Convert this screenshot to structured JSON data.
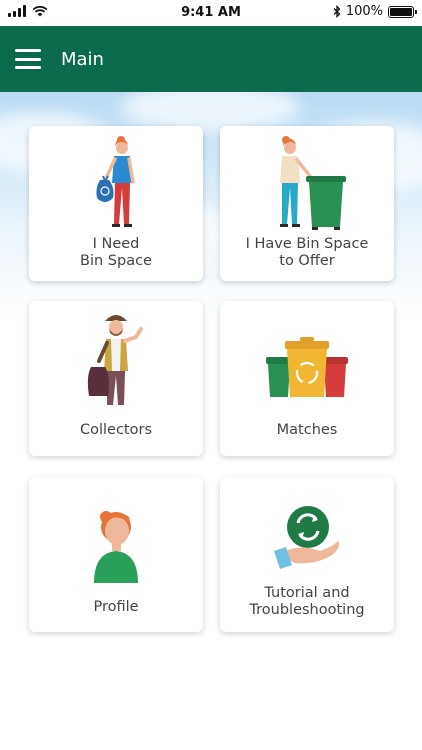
{
  "status_bar": {
    "time": "9:41 AM",
    "battery": "100%"
  },
  "app_bar": {
    "title": "Main",
    "menu_icon": "hamburger-menu-icon"
  },
  "cards": [
    {
      "id": "need-bin",
      "label_line1": "I Need",
      "label_line2": "Bin Space",
      "icon": "woman-with-trash-bag-icon"
    },
    {
      "id": "offer-bin",
      "label_line1": "I Have Bin Space",
      "label_line2": "to Offer",
      "icon": "woman-with-green-bin-icon"
    },
    {
      "id": "collectors",
      "label_line1": "Collectors",
      "label_line2": "",
      "icon": "collector-man-icon"
    },
    {
      "id": "matches",
      "label_line1": "Matches",
      "label_line2": "",
      "icon": "recycling-bins-icon"
    },
    {
      "id": "profile",
      "label_line1": "Profile",
      "label_line2": "",
      "icon": "profile-avatar-icon"
    },
    {
      "id": "tutorial",
      "label_line1": "Tutorial and",
      "label_line2": "Troubleshooting",
      "icon": "recycle-hand-icon"
    }
  ],
  "colors": {
    "app_bar": "#0b6b4c",
    "accent_green": "#1a7a52"
  }
}
